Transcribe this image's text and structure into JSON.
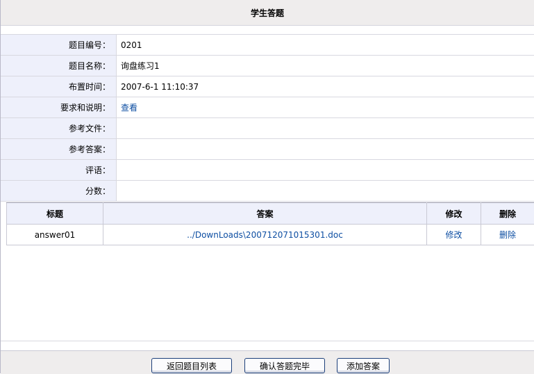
{
  "page": {
    "title": "学生答题"
  },
  "info": {
    "rows": [
      {
        "label": "题目编号：",
        "value": "0201"
      },
      {
        "label": "题目名称：",
        "value": "询盘练习1"
      },
      {
        "label": "布置时间：",
        "value": "2007-6-1 11:10:37"
      },
      {
        "label": "要求和说明：",
        "value": "查看"
      },
      {
        "label": "参考文件：",
        "value": ""
      },
      {
        "label": "参考答案：",
        "value": ""
      },
      {
        "label": "评语：",
        "value": ""
      },
      {
        "label": "分数：",
        "value": ""
      }
    ]
  },
  "answers": {
    "headers": [
      "标题",
      "答案",
      "修改",
      "删除"
    ],
    "rows": [
      {
        "title": "answer01",
        "file": "../DownLoads\\200712071015301.doc",
        "edit": "修改",
        "delete": "删除"
      }
    ]
  },
  "footer": {
    "back_label": "返回题目列表",
    "confirm_label": "确认答题完毕",
    "add_label": "添加答案"
  },
  "colors": {
    "link": "#0d4ea2",
    "label_bg": "#eef0fb",
    "bar_bg": "#efeded"
  }
}
